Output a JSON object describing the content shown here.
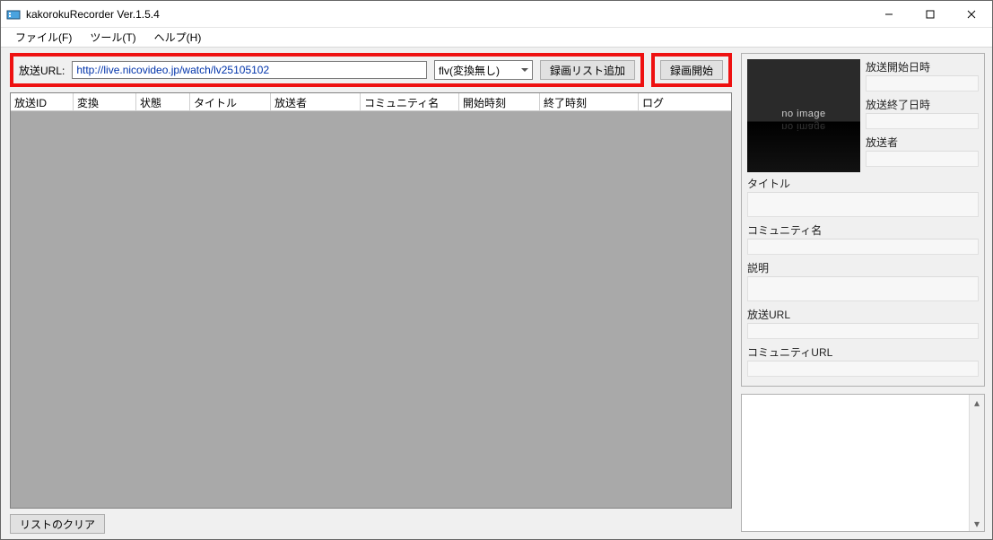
{
  "window": {
    "title": "kakorokuRecorder Ver.1.5.4"
  },
  "menu": {
    "file": "ファイル(F)",
    "tool": "ツール(T)",
    "help": "ヘルプ(H)"
  },
  "urlbar": {
    "label": "放送URL:",
    "value": "http://live.nicovideo.jp/watch/lv25105102",
    "format_selected": "flv(変換無し)",
    "add_button": "録画リスト追加",
    "start_button": "録画開始"
  },
  "grid": {
    "columns": [
      "放送ID",
      "変換",
      "状態",
      "タイトル",
      "放送者",
      "コミュニティ名",
      "開始時刻",
      "終了時刻",
      "ログ"
    ]
  },
  "bottom": {
    "clear_button": "リストのクリア"
  },
  "info": {
    "thumbnail_text": "no image",
    "labels": {
      "start_dt": "放送開始日時",
      "end_dt": "放送終了日時",
      "broadcaster": "放送者",
      "title": "タイトル",
      "community": "コミュニティ名",
      "description": "説明",
      "broadcast_url": "放送URL",
      "community_url": "コミュニティURL"
    }
  }
}
